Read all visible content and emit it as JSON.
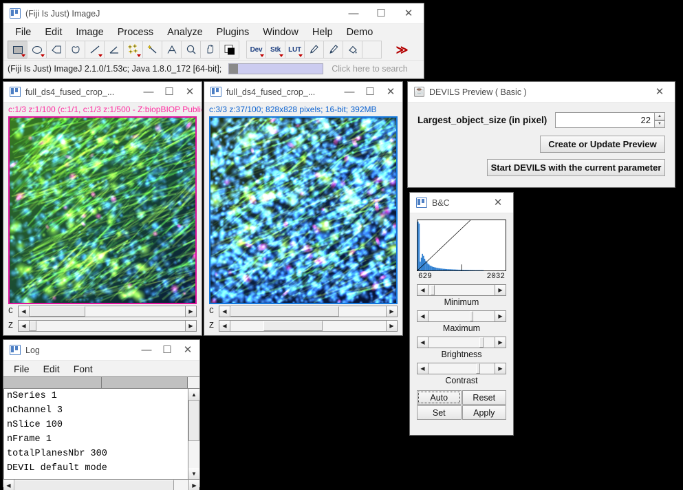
{
  "main_window": {
    "title": "(Fiji Is Just) ImageJ",
    "icon": "imagej-icon",
    "controls": {
      "minimize": "—",
      "maximize": "☐",
      "close": "✕"
    },
    "menus": [
      "File",
      "Edit",
      "Image",
      "Process",
      "Analyze",
      "Plugins",
      "Window",
      "Help",
      "Demo"
    ],
    "toolbar": [
      {
        "name": "rectangle-tool",
        "kind": "shape",
        "selected": true,
        "dropdown": true
      },
      {
        "name": "oval-tool",
        "kind": "shape",
        "selected": false,
        "dropdown": true
      },
      {
        "name": "polygon-tool",
        "kind": "shape",
        "selected": false,
        "dropdown": false
      },
      {
        "name": "freehand-tool",
        "kind": "shape",
        "selected": false,
        "dropdown": false
      },
      {
        "name": "straight-line-tool",
        "kind": "shape",
        "selected": false,
        "dropdown": true
      },
      {
        "name": "angle-tool",
        "kind": "shape",
        "selected": false,
        "dropdown": false
      },
      {
        "name": "point-tool",
        "kind": "shape",
        "selected": false,
        "dropdown": true
      },
      {
        "name": "wand-tool",
        "kind": "shape",
        "selected": false,
        "dropdown": false
      },
      {
        "name": "text-tool",
        "kind": "shape",
        "selected": false,
        "dropdown": false
      },
      {
        "name": "magnifier-tool",
        "kind": "shape",
        "selected": false,
        "dropdown": false
      },
      {
        "name": "hand-tool",
        "kind": "shape",
        "selected": false,
        "dropdown": false
      },
      {
        "name": "color-picker-tool",
        "kind": "shape",
        "selected": false,
        "dropdown": false
      },
      {
        "name": "dev-tool",
        "kind": "text",
        "label": "Dev",
        "selected": false,
        "dropdown": true
      },
      {
        "name": "stk-tool",
        "kind": "text",
        "label": "Stk",
        "selected": false,
        "dropdown": true
      },
      {
        "name": "lut-tool",
        "kind": "text",
        "label": "LUT",
        "selected": false,
        "dropdown": true
      },
      {
        "name": "pencil-tool",
        "kind": "shape",
        "selected": false,
        "dropdown": false
      },
      {
        "name": "brush-tool",
        "kind": "shape",
        "selected": false,
        "dropdown": false
      },
      {
        "name": "flood-fill-tool",
        "kind": "shape",
        "selected": false,
        "dropdown": false
      },
      {
        "name": "spare-tool",
        "kind": "shape",
        "selected": false,
        "dropdown": false
      },
      {
        "name": "more-tools-button",
        "kind": "chev",
        "label": "≫",
        "selected": false,
        "dropdown": false
      }
    ],
    "status": {
      "text": "(Fiji Is Just) ImageJ 2.1.0/1.53c; Java 1.8.0_172 [64-bit];",
      "search_placeholder": "Click here to search",
      "progress_percent": 0
    }
  },
  "image_window_1": {
    "title": "full_ds4_fused_crop_...",
    "info": "c:1/3 z:1/100 (c:1/1, c:1/3 z:1/500 - Z:biopBIOP Public",
    "info_color": "#ff2ca0",
    "border_color": "#e0139c",
    "channel_slider": {
      "label": "C",
      "value": 1,
      "max": 3
    },
    "slice_slider": {
      "label": "Z",
      "value": 1,
      "max": 100
    }
  },
  "image_window_2": {
    "title": "full_ds4_fused_crop_...",
    "info": "c:3/3 z:37/100; 828x828 pixels; 16-bit; 392MB",
    "info_color": "#0b62d0",
    "border_color": "#1478dd",
    "channel_slider": {
      "label": "C",
      "value": 3,
      "max": 3
    },
    "slice_slider": {
      "label": "Z",
      "value": 37,
      "max": 100
    }
  },
  "devils_dialog": {
    "title": "DEVILS Preview ( Basic )",
    "icon": "java-icon",
    "close": "✕",
    "field_label": "Largest_object_size (in pixel)",
    "field_value": "22",
    "spinner_up": "▲",
    "spinner_down": "▼",
    "preview_button": "Create or Update Preview",
    "start_button": "Start DEVILS with the current parameter"
  },
  "bc_window": {
    "title": "B&C",
    "icon": "imagej-icon",
    "close": "✕",
    "hist_min_label": "629",
    "hist_max_label": "2032",
    "sliders": [
      {
        "name": "minimum-slider",
        "label": "Minimum",
        "position_percent": 3
      },
      {
        "name": "maximum-slider",
        "label": "Maximum",
        "position_percent": 62
      },
      {
        "name": "brightness-slider",
        "label": "Brightness",
        "position_percent": 77
      },
      {
        "name": "contrast-slider",
        "label": "Contrast",
        "position_percent": 72
      }
    ],
    "buttons": [
      {
        "name": "auto-button",
        "label": "Auto",
        "focused": true
      },
      {
        "name": "reset-button",
        "label": "Reset",
        "focused": false
      },
      {
        "name": "set-button",
        "label": "Set",
        "focused": false
      },
      {
        "name": "apply-button",
        "label": "Apply",
        "focused": false
      }
    ],
    "histogram": {
      "accent_color": "#2f7fd0",
      "bins": [
        100,
        96,
        18,
        26,
        34,
        30,
        24,
        20,
        17,
        14,
        12,
        10,
        9,
        8,
        7,
        6.5,
        6,
        5.5,
        5,
        4.6,
        4.2,
        4,
        3.7,
        3.4,
        3.2,
        3,
        2.8,
        2.6,
        2.5,
        2.4,
        2.3,
        2.2,
        2.1,
        2,
        1.9,
        1.8,
        1.7,
        1.6,
        1.55,
        1.5,
        1.45,
        1.4,
        1.35,
        1.3,
        1.25,
        1.2,
        1.15,
        1.1,
        1.05,
        1.0,
        0.95,
        0.9,
        0.85,
        0.8,
        0.75,
        0.7,
        0.65,
        0.6,
        0.55,
        0.5,
        0,
        0,
        0,
        0,
        0,
        0,
        0,
        0,
        0,
        0,
        0,
        0,
        0,
        0,
        0,
        0,
        0,
        0,
        0,
        0
      ],
      "line_end_percent": 60,
      "tick_percent": 50
    }
  },
  "log_window": {
    "title": "Log",
    "icon": "imagej-icon",
    "controls": {
      "minimize": "—",
      "maximize": "☐",
      "close": "✕"
    },
    "menus": [
      "File",
      "Edit",
      "Font"
    ],
    "lines": [
      "nSeries 1",
      "nChannel 3",
      "nSlice 100",
      "nFrame 1",
      "totalPlanesNbr 300",
      "DEVIL default mode"
    ],
    "scroll_up": "▲",
    "scroll_down": "▼",
    "scroll_left": "◀",
    "scroll_right": "▶"
  }
}
